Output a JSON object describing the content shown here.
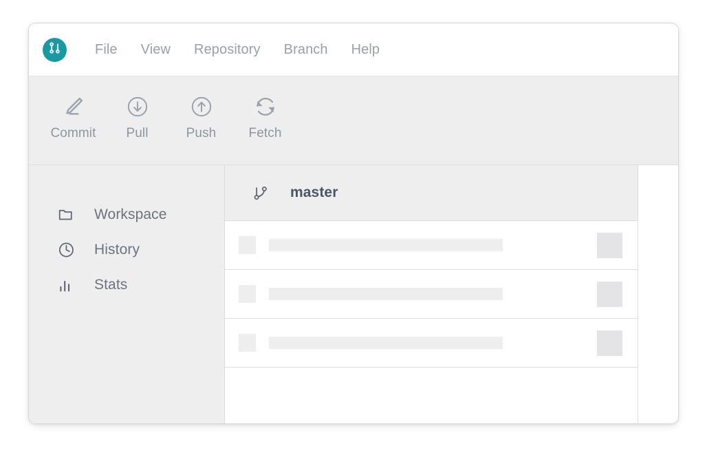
{
  "window": {
    "accent_color": "#179aa2",
    "toolbar_bg": "#eeeeee",
    "sidebar_bg": "#eeeeee",
    "border_color": "#dcdcdc",
    "placeholder_color": "#eeeeee",
    "badge_color": "#e4e4e6",
    "text_color": "#6b7280",
    "menu_text_color": "#9aa0a6"
  },
  "logo": {
    "icon": "git-branch-icon",
    "background": "#179aa2"
  },
  "menubar": {
    "items": [
      {
        "label": "File",
        "name": "menu-file"
      },
      {
        "label": "View",
        "name": "menu-view"
      },
      {
        "label": "Repository",
        "name": "menu-repository"
      },
      {
        "label": "Branch",
        "name": "menu-branch"
      },
      {
        "label": "Help",
        "name": "menu-help"
      }
    ]
  },
  "toolbar": {
    "buttons": [
      {
        "label": "Commit",
        "icon": "pencil-icon"
      },
      {
        "label": "Pull",
        "icon": "arrow-down-circle-icon"
      },
      {
        "label": "Push",
        "icon": "arrow-up-circle-icon"
      },
      {
        "label": "Fetch",
        "icon": "sync-refresh-icon"
      }
    ]
  },
  "sidebar": {
    "items": [
      {
        "label": "Workspace",
        "icon": "folder-icon"
      },
      {
        "label": "History",
        "icon": "clock-icon"
      },
      {
        "label": "Stats",
        "icon": "bar-chart-icon"
      }
    ]
  },
  "commit_panel": {
    "branch": {
      "icon": "git-branch-icon",
      "name": "master"
    },
    "rows": [
      {
        "avatar": "placeholder",
        "message": "placeholder",
        "badge": "placeholder"
      },
      {
        "avatar": "placeholder",
        "message": "placeholder",
        "badge": "placeholder"
      },
      {
        "avatar": "placeholder",
        "message": "placeholder",
        "badge": "placeholder"
      }
    ]
  },
  "detail_panel": {
    "content": ""
  }
}
